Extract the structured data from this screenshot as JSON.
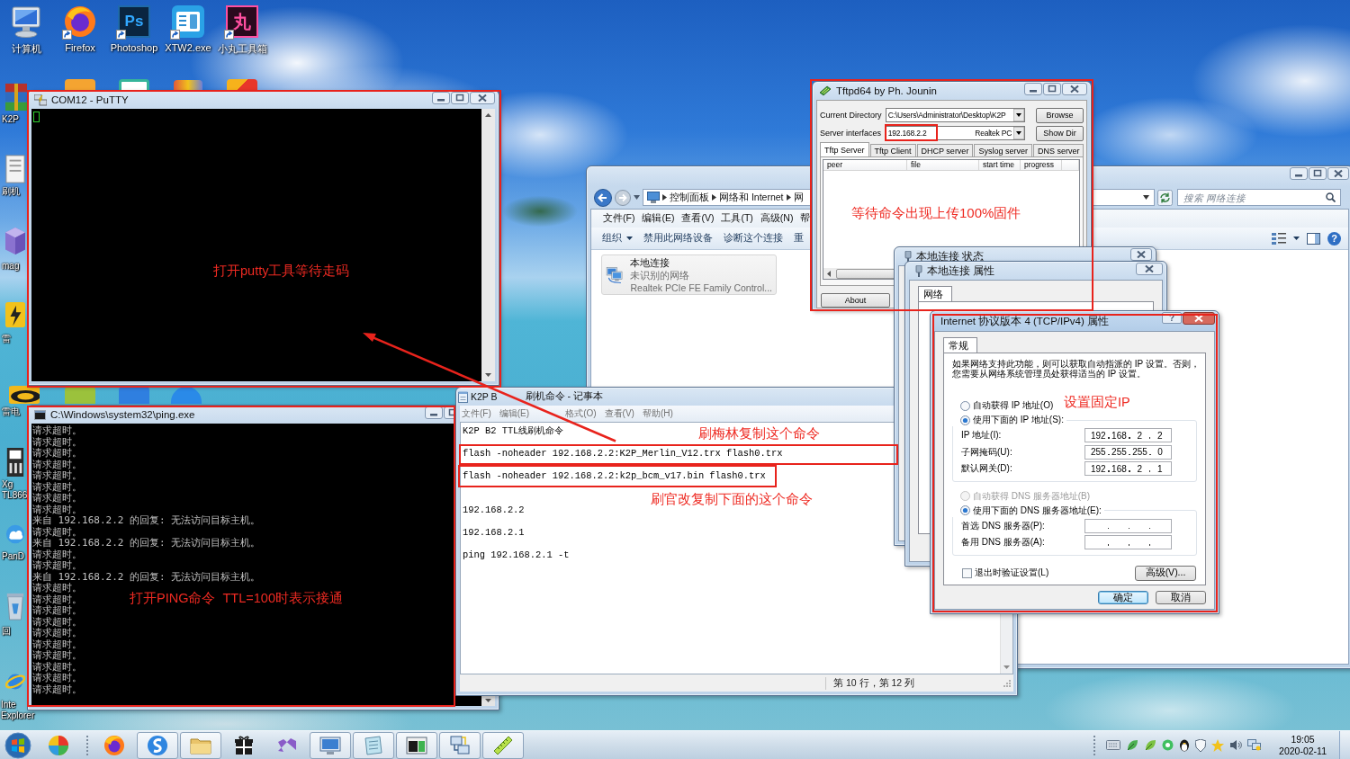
{
  "desktop": {
    "top_icons": [
      {
        "label": "计算机",
        "shortcut": false
      },
      {
        "label": "Firefox",
        "shortcut": true
      },
      {
        "label": "Photoshop",
        "shortcut": true,
        "icon_text": "Ps"
      },
      {
        "label": "XTW2.exe",
        "shortcut": true
      },
      {
        "label": "小丸工具箱",
        "shortcut": true,
        "icon_text": "丸"
      }
    ],
    "left_icons": [
      {
        "lines": [
          "K2P"
        ]
      },
      {
        "lines": [
          "刷机"
        ]
      },
      {
        "lines": [
          "mag"
        ]
      },
      {
        "lines": [
          "雷"
        ]
      },
      {
        "lines": [
          "雷电"
        ]
      },
      {
        "lines": [
          "Xg",
          "TL866"
        ]
      },
      {
        "lines": [
          "PanD"
        ]
      },
      {
        "lines": [
          "回"
        ]
      },
      {
        "lines": [
          "Inte",
          "Explorer"
        ]
      }
    ]
  },
  "explorer": {
    "path": [
      "控制面板",
      "网络和 Internet",
      "网"
    ],
    "search": {
      "placeholder": "搜索 网络连接"
    },
    "menu": [
      "文件(F)",
      "编辑(E)",
      "查看(V)",
      "工具(T)",
      "高级(N)",
      "帮"
    ],
    "toolbar": [
      {
        "label": "组织",
        "menu": true
      },
      {
        "label": "禁用此网络设备",
        "menu": false
      },
      {
        "label": "诊断这个连接",
        "menu": false
      },
      {
        "label": "重",
        "menu": false
      }
    ],
    "help": "?",
    "items": [
      {
        "name": "本地连接",
        "status": "未识别的网络",
        "device": "Realtek PCIe FE Family Control...",
        "selected": true
      }
    ]
  },
  "putty": {
    "title": "COM12 - PuTTY",
    "annotation": "打开putty工具等待走码"
  },
  "ping": {
    "title": "C:\\Windows\\system32\\ping.exe",
    "output": [
      "请求超时。",
      "请求超时。",
      "请求超时。",
      "请求超时。",
      "请求超时。",
      "请求超时。",
      "请求超时。",
      "请求超时。",
      "来自 192.168.2.2 的回复: 无法访问目标主机。",
      "请求超时。",
      "来自 192.168.2.2 的回复: 无法访问目标主机。",
      "请求超时。",
      "请求超时。",
      "来自 192.168.2.2 的回复: 无法访问目标主机。",
      "请求超时。",
      "请求超时。",
      "请求超时。",
      "请求超时。",
      "请求超时。",
      "请求超时。",
      "请求超时。",
      "请求超时。",
      "请求超时。",
      "请求超时。"
    ],
    "annotation": "打开PING命令  TTL=100时表示接通"
  },
  "notepad": {
    "title_parts": [
      "K2P B",
      "刷机命令 - 记事本"
    ],
    "menu": [
      "文件(F)",
      "编辑(E)",
      "格式(O)",
      "查看(V)",
      "帮助(H)"
    ],
    "content": "K2P B2 TTL线刷机命令\n\nflash -noheader 192.168.2.2:K2P_Merlin_V12.trx flash0.trx\n\nflash -noheader 192.168.2.2:k2p_bcm_v17.bin flash0.trx\n\n\n192.168.2.2\n\n192.168.2.1\n\nping 192.168.2.1 -t",
    "status": "第 10 行，第 12 列",
    "annotations": [
      "刷梅林复制这个命令",
      "刷官改复制下面的这个命令"
    ]
  },
  "tftpd": {
    "title": "Tftpd64 by Ph. Jounin",
    "current_directory": {
      "label": "Current Directory",
      "value": "C:\\Users\\Administrator\\Desktop\\K2P"
    },
    "server_interfaces": {
      "label": "Server interfaces",
      "address": "192.168.2.2",
      "adapter": "Realtek PC"
    },
    "buttons": [
      "Browse",
      "Show Dir"
    ],
    "tabs": [
      {
        "label": "Tftp Server",
        "selected": true
      },
      {
        "label": "Tftp Client",
        "selected": false
      },
      {
        "label": "DHCP server",
        "selected": false
      },
      {
        "label": "Syslog server",
        "selected": false
      },
      {
        "label": "DNS server",
        "selected": false
      }
    ],
    "columns": [
      "peer",
      "file",
      "start time",
      "progress"
    ],
    "about": "About",
    "annotation": "等待命令出现上传100%固件"
  },
  "status_dialog": {
    "title": "本地连接 状态"
  },
  "properties_dialog": {
    "title": "本地连接 属性",
    "tabs": [
      {
        "label": "网络",
        "selected": true
      }
    ]
  },
  "ipv4_dialog": {
    "title": "Internet 协议版本 4 (TCP/IPv4) 属性",
    "help": "?",
    "tabs": [
      {
        "label": "常规",
        "selected": true
      }
    ],
    "description": "如果网络支持此功能，则可以获取自动指派的 IP 设置。否则，您需要从网络系统管理员处获得适当的 IP 设置。",
    "ip_options": [
      {
        "label": "自动获得 IP 地址(O)",
        "selected": false,
        "disabled": false
      },
      {
        "label": "使用下面的 IP 地址(S):",
        "selected": true,
        "disabled": false
      }
    ],
    "ip_fields": [
      {
        "label": "IP 地址(I):",
        "octets": [
          "192",
          "168",
          "2",
          "2"
        ]
      },
      {
        "label": "子网掩码(U):",
        "octets": [
          "255",
          "255",
          "255",
          "0"
        ]
      },
      {
        "label": "默认网关(D):",
        "octets": [
          "192",
          "168",
          "2",
          "1"
        ]
      }
    ],
    "dns_options": [
      {
        "label": "自动获得 DNS 服务器地址(B)",
        "selected": false,
        "disabled": true
      },
      {
        "label": "使用下面的 DNS 服务器地址(E):",
        "selected": true,
        "disabled": false
      }
    ],
    "dns_fields": [
      {
        "label": "首选 DNS 服务器(P):"
      },
      {
        "label": "备用 DNS 服务器(A):"
      }
    ],
    "validate": {
      "label": "退出时验证设置(L)",
      "checked": false
    },
    "advanced": "高级(V)...",
    "ok": "确定",
    "cancel": "取消",
    "annotation": "设置固定IP"
  },
  "taskbar": {
    "items": [
      {
        "running": false
      },
      {
        "running": false
      },
      {
        "running": true
      },
      {
        "running": true
      },
      {
        "running": false
      },
      {
        "running": false
      },
      {
        "running": true
      },
      {
        "running": true
      },
      {
        "running": true
      },
      {
        "running": true
      },
      {
        "running": true
      }
    ],
    "clock": {
      "time": "19:05",
      "date": "2020-02-11"
    }
  }
}
